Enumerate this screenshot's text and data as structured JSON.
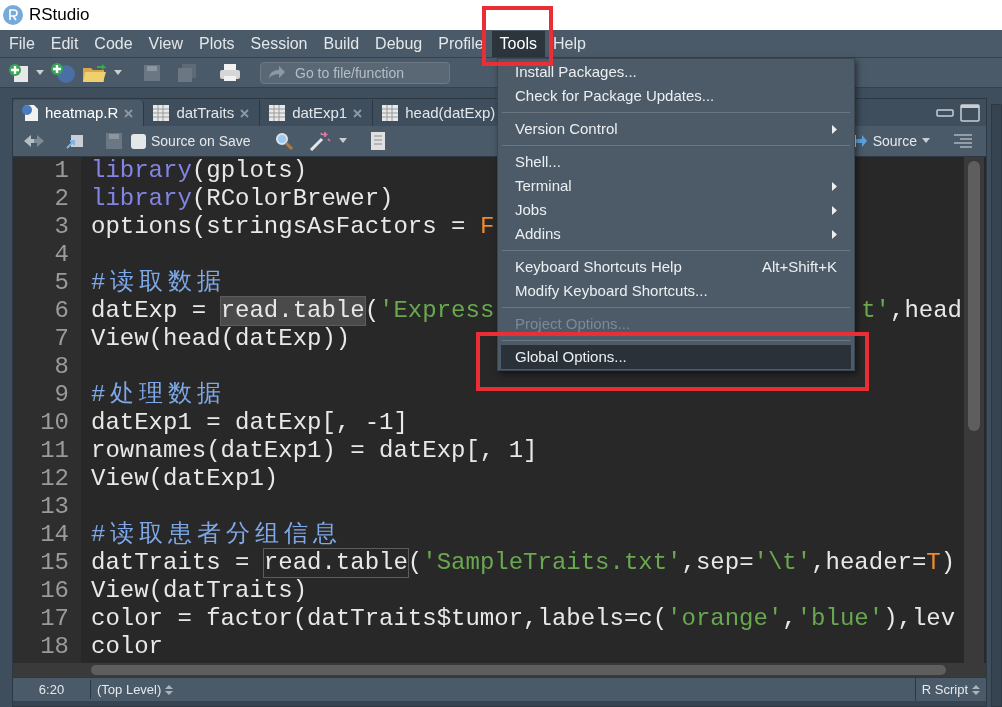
{
  "window": {
    "title": "RStudio"
  },
  "menubar": [
    {
      "label": "File",
      "selected": false,
      "highlighted": false
    },
    {
      "label": "Edit",
      "selected": false,
      "highlighted": false
    },
    {
      "label": "Code",
      "selected": false,
      "highlighted": false
    },
    {
      "label": "View",
      "selected": false,
      "highlighted": false
    },
    {
      "label": "Plots",
      "selected": false,
      "highlighted": false
    },
    {
      "label": "Session",
      "selected": false,
      "highlighted": false
    },
    {
      "label": "Build",
      "selected": false,
      "highlighted": false
    },
    {
      "label": "Debug",
      "selected": false,
      "highlighted": false
    },
    {
      "label": "Profile",
      "selected": false,
      "highlighted": false
    },
    {
      "label": "Tools",
      "selected": true,
      "highlighted": true
    },
    {
      "label": "Help",
      "selected": false,
      "highlighted": false
    }
  ],
  "toolbar": {
    "goto_placeholder": "Go to file/function"
  },
  "editor_tabs": [
    {
      "label": "heatmap.R",
      "kind": "script",
      "selected": true,
      "close_button": true
    },
    {
      "label": "datTraits",
      "kind": "data",
      "selected": false,
      "close_button": true
    },
    {
      "label": "datExp1",
      "kind": "data",
      "selected": false,
      "close_button": true
    },
    {
      "label": "head(datExp)",
      "kind": "data",
      "selected": false,
      "close_button": false
    }
  ],
  "editor_toolbar": {
    "source_on_save": {
      "label": "Source on Save",
      "checked": false
    },
    "source_button": "Source"
  },
  "code_lines": [
    {
      "number": "1",
      "code": [
        {
          "text": "library",
          "kind": "keyword"
        },
        {
          "text": "(gplots)",
          "kind": "plain"
        }
      ]
    },
    {
      "number": "2",
      "code": [
        {
          "text": "library",
          "kind": "keyword"
        },
        {
          "text": "(RColorBrewer)",
          "kind": "plain"
        }
      ]
    },
    {
      "number": "3",
      "code": [
        {
          "text": "options(stringsAsFactors = ",
          "kind": "plain"
        },
        {
          "text": "F",
          "kind": "constant"
        }
      ]
    },
    {
      "number": "4"
    },
    {
      "number": "5",
      "code": [
        {
          "text": "#读取数据",
          "kind": "comment"
        }
      ]
    },
    {
      "number": "6",
      "code": [
        {
          "text": "datExp = ",
          "kind": "plain"
        },
        {
          "text": "read.table",
          "kind": "match-current"
        },
        {
          "text": "(",
          "kind": "plain"
        },
        {
          "text": "'Express",
          "kind": "string"
        }
      ],
      "tail": [
        {
          "text": "t'",
          "kind": "string"
        },
        {
          "text": ",head",
          "kind": "plain"
        }
      ]
    },
    {
      "number": "7",
      "code": [
        {
          "text": "View(head(datExp))",
          "kind": "plain"
        }
      ]
    },
    {
      "number": "8"
    },
    {
      "number": "9",
      "code": [
        {
          "text": "#处理数据",
          "kind": "comment"
        }
      ]
    },
    {
      "number": "10",
      "code": [
        {
          "text": "datExp1 = datExp[, -1]",
          "kind": "plain"
        }
      ]
    },
    {
      "number": "11",
      "code": [
        {
          "text": "rownames(datExp1) = datExp[, 1]",
          "kind": "plain"
        }
      ]
    },
    {
      "number": "12",
      "code": [
        {
          "text": "View(datExp1)",
          "kind": "plain"
        }
      ]
    },
    {
      "number": "13"
    },
    {
      "number": "14",
      "code": [
        {
          "text": "#读取患者分组信息",
          "kind": "comment"
        }
      ]
    },
    {
      "number": "15",
      "code": [
        {
          "text": "datTraits = ",
          "kind": "plain"
        },
        {
          "text": "read.table",
          "kind": "match"
        },
        {
          "text": "(",
          "kind": "plain"
        },
        {
          "text": "'SampleTraits.txt'",
          "kind": "string"
        },
        {
          "text": ",sep=",
          "kind": "plain"
        },
        {
          "text": "'\\t'",
          "kind": "string"
        },
        {
          "text": ",header=",
          "kind": "plain"
        },
        {
          "text": "T",
          "kind": "constant"
        },
        {
          "text": ")",
          "kind": "plain"
        }
      ]
    },
    {
      "number": "16",
      "code": [
        {
          "text": "View(datTraits)",
          "kind": "plain"
        }
      ]
    },
    {
      "number": "17",
      "code": [
        {
          "text": "color = factor(datTraits$tumor,labels=c(",
          "kind": "plain"
        },
        {
          "text": "'orange'",
          "kind": "string"
        },
        {
          "text": ",",
          "kind": "plain"
        },
        {
          "text": "'blue'",
          "kind": "string"
        },
        {
          "text": "),lev",
          "kind": "plain"
        }
      ]
    },
    {
      "number": "18",
      "code": [
        {
          "text": "color",
          "kind": "plain"
        }
      ]
    }
  ],
  "status_bar": {
    "position": "6:20",
    "scope": "(Top Level)",
    "file_type": "R Script"
  },
  "tools_menu": [
    {
      "kind": "item",
      "label": "Install Packages...",
      "submenu": false,
      "disabled": false,
      "selected": false,
      "highlighted": false
    },
    {
      "kind": "item",
      "label": "Check for Package Updates...",
      "submenu": false,
      "disabled": false,
      "selected": false,
      "highlighted": false
    },
    {
      "kind": "separator"
    },
    {
      "kind": "item",
      "label": "Version Control",
      "submenu": true,
      "disabled": false,
      "selected": false,
      "highlighted": false
    },
    {
      "kind": "separator"
    },
    {
      "kind": "item",
      "label": "Shell...",
      "submenu": false,
      "disabled": false,
      "selected": false,
      "highlighted": false
    },
    {
      "kind": "item",
      "label": "Terminal",
      "submenu": true,
      "disabled": false,
      "selected": false,
      "highlighted": false
    },
    {
      "kind": "item",
      "label": "Jobs",
      "submenu": true,
      "disabled": false,
      "selected": false,
      "highlighted": false
    },
    {
      "kind": "item",
      "label": "Addins",
      "submenu": true,
      "disabled": false,
      "selected": false,
      "highlighted": false
    },
    {
      "kind": "separator"
    },
    {
      "kind": "item",
      "label": "Keyboard Shortcuts Help",
      "shortcut": "Alt+Shift+K",
      "submenu": false,
      "disabled": false,
      "selected": false,
      "highlighted": false
    },
    {
      "kind": "item",
      "label": "Modify Keyboard Shortcuts...",
      "submenu": false,
      "disabled": false,
      "selected": false,
      "highlighted": false
    },
    {
      "kind": "separator"
    },
    {
      "kind": "item",
      "label": "Project Options...",
      "submenu": false,
      "disabled": true,
      "selected": false,
      "highlighted": false
    },
    {
      "kind": "separator"
    },
    {
      "kind": "item",
      "label": "Global Options...",
      "submenu": false,
      "disabled": false,
      "selected": true,
      "highlighted": true
    }
  ]
}
